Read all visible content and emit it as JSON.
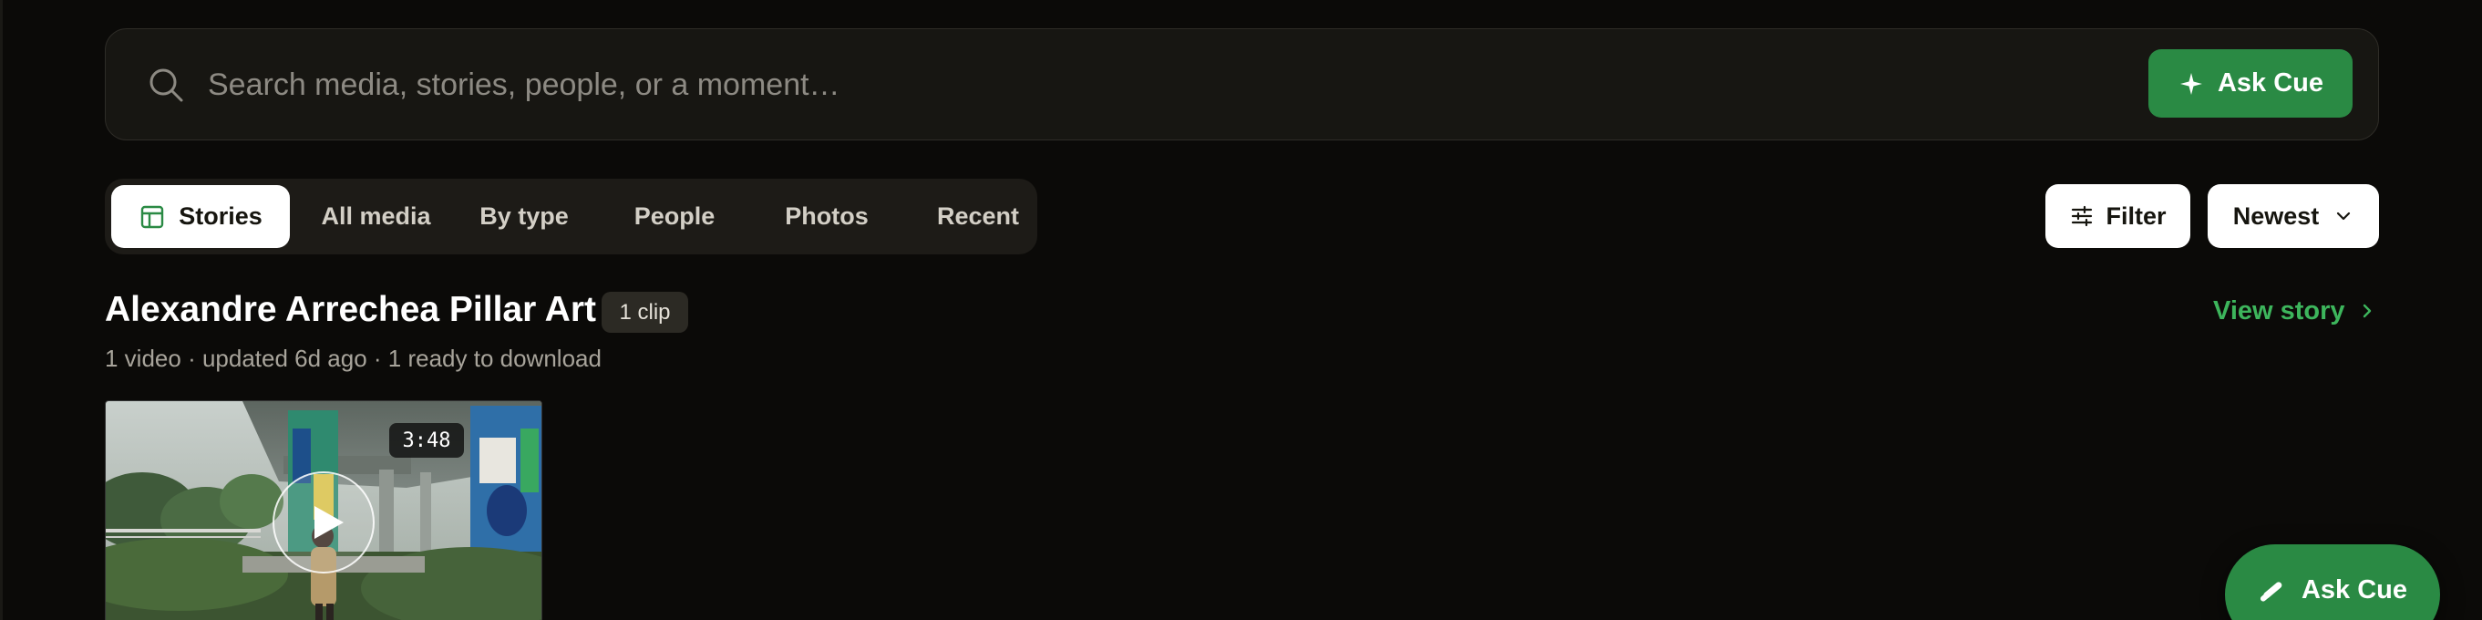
{
  "search": {
    "placeholder": "Search media, stories, people, or a moment…",
    "value": "",
    "ask_label": "Ask Cue"
  },
  "tabs": [
    {
      "label": "Stories",
      "active": true
    },
    {
      "label": "All media",
      "active": false
    },
    {
      "label": "By type",
      "active": false
    },
    {
      "label": "People",
      "active": false
    },
    {
      "label": "Photos",
      "active": false
    },
    {
      "label": "Recent",
      "active": false
    }
  ],
  "toolbar": {
    "filter_label": "Filter",
    "sort_label": "Newest"
  },
  "story": {
    "title": "Alexandre Arrechea Pillar Art",
    "badge": "1 clip",
    "meta": "1 video · updated 6d ago · 1 ready to download",
    "view_label": "View story",
    "clips": [
      {
        "duration": "3:48"
      }
    ]
  },
  "fab": {
    "label": "Ask Cue"
  },
  "colors": {
    "background": "#0b0a08",
    "accent": "#2a8a44",
    "link": "#3db55c",
    "surface": "#171612"
  },
  "icons": {
    "search": "search-icon",
    "ask": "sparkle-icon",
    "stories_tab": "layout-icon",
    "filter": "sliders-icon",
    "sort": "chevron-down-icon",
    "view_story": "chevron-right-icon",
    "play": "play-icon",
    "fab": "magic-wand-icon"
  }
}
